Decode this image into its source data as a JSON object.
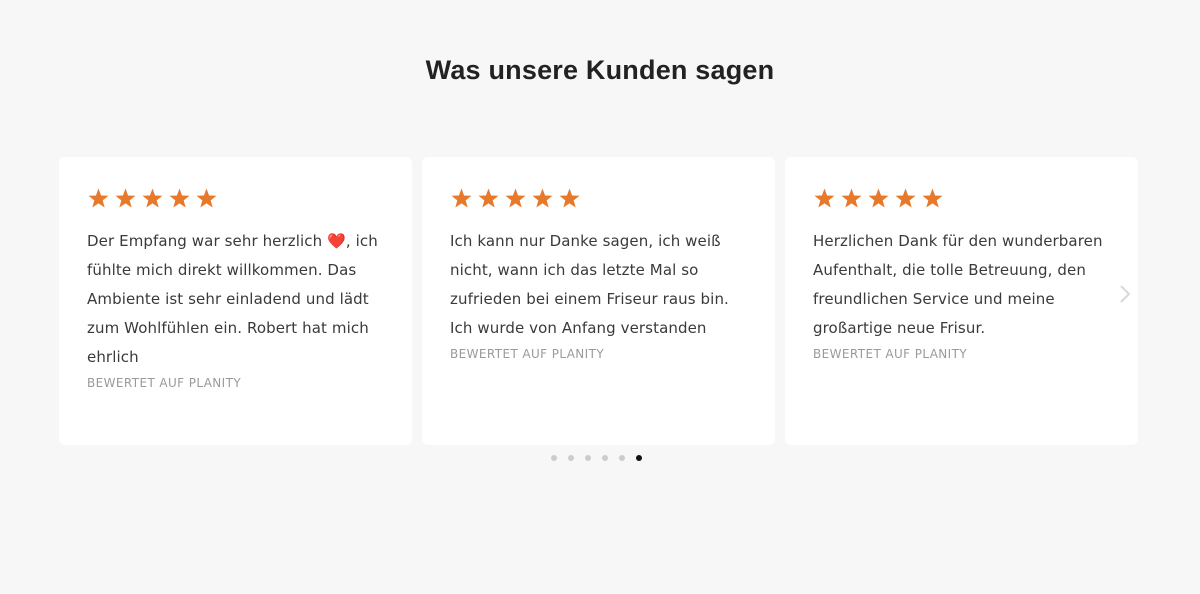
{
  "section": {
    "title": "Was unsere Kunden sagen"
  },
  "colors": {
    "star": "#e8792b",
    "background": "#f7f7f7",
    "card": "#ffffff",
    "dot_inactive": "#cccccc",
    "dot_active": "#111111"
  },
  "reviews": [
    {
      "rating": 5,
      "text": "Der Empfang war sehr herzlich ❤️, ich\nfühlte mich direkt willkommen. Das\nAmbiente ist sehr einladend und lädt\nzum Wohlfühlen ein. Robert hat mich\nehrlich",
      "source": "BEWERTET AUF PLANITY"
    },
    {
      "rating": 5,
      "text": "Ich kann nur Danke sagen, ich weiß\nnicht, wann ich das letzte Mal so\nzufrieden bei einem Friseur raus bin.\nIch wurde von Anfang verstanden",
      "source": "BEWERTET AUF PLANITY"
    },
    {
      "rating": 5,
      "text": "Herzlichen Dank für den wunderbaren\nAufenthalt, die tolle Betreuung, den\nfreundlichen Service und meine\ngroßartige neue Frisur.",
      "source": "BEWERTET AUF PLANITY"
    }
  ],
  "navigation": {
    "prev_icon": "chevron-left-icon",
    "next_icon": "chevron-right-icon"
  },
  "pagination": {
    "total": 6,
    "active_index": 5
  }
}
